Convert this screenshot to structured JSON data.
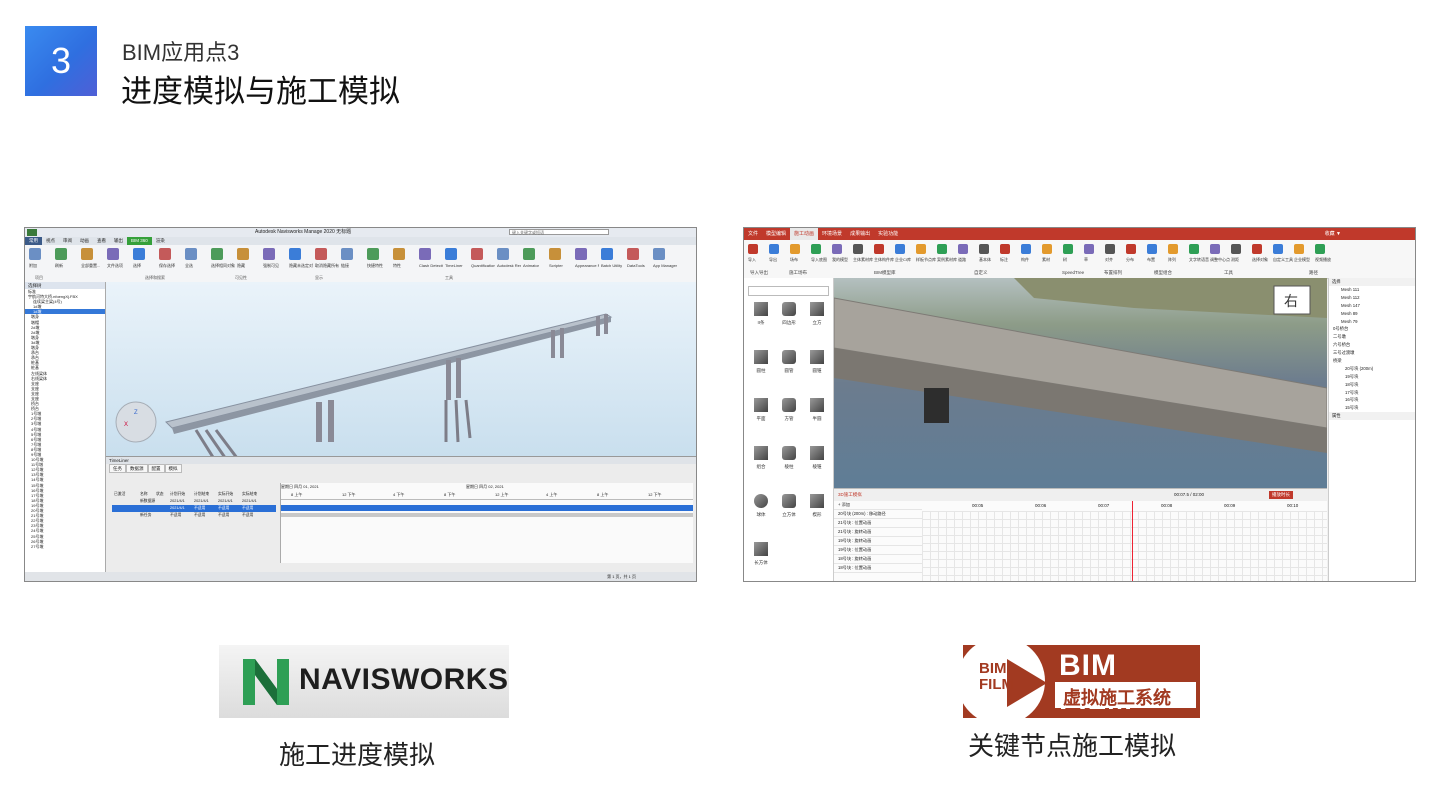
{
  "section": {
    "number": "3",
    "subtitle": "BIM应用点3",
    "title": "进度模拟与施工模拟"
  },
  "navisworks": {
    "window_title": "Autodesk Navisworks Manage 2020  无标题",
    "search_placeholder": "键入关键字或短语",
    "tabs": [
      "常用",
      "视点",
      "审阅",
      "动画",
      "查看",
      "输出",
      "BIM 360",
      "渲染"
    ],
    "ribbon_items": [
      "附加",
      "刷新",
      "全部重置...",
      "文件选项",
      "选择",
      "保存选择",
      "全选",
      "选择相同对象",
      "隐藏",
      "强制可见",
      "隐藏未选定对象",
      "取消隐藏所有对象",
      "链接",
      "快捷特性",
      "特性",
      "Clash Detective",
      "TimeLiner",
      "Quantification",
      "Autodesk Rendering",
      "Animator",
      "Scripter",
      "Appearance Profiler",
      "Batch Utility",
      "DataTools",
      "App Manager"
    ],
    "ribbon_groups": [
      "项目",
      "选择和搜索",
      "可见性",
      "显示",
      "工具"
    ],
    "tree_header": "选择树",
    "tree_dropdown": "标准",
    "tree_items": [
      "标准",
      "宇航河特大桥.nfoengXj.FBX",
      "连续梁主梁(4号)",
      "1#墩",
      "1#墩",
      "墩身",
      "墩帽",
      "2#墩",
      "2#墩",
      "墩身",
      "3#墩",
      "墩身",
      "承台",
      "承台",
      "桩基",
      "桩基",
      "左线梁体",
      "右线梁体",
      "支座",
      "支座",
      "支座",
      "支座",
      "桥台",
      "桥台",
      "1号墩",
      "2号墩",
      "3号墩",
      "4号墩",
      "5号墩",
      "6号墩",
      "7号墩",
      "8号墩",
      "9号墩",
      "10号墩",
      "11号墩",
      "12号墩",
      "13号墩",
      "14号墩",
      "15号墩",
      "16号墩",
      "17号墩",
      "18号墩",
      "19号墩",
      "20号墩",
      "21号墩",
      "22号墩",
      "23号墩",
      "24号墩",
      "25号墩",
      "26号墩",
      "27号墩"
    ],
    "timeliner": {
      "title": "TimeLiner",
      "tabs": [
        "任务",
        "数据源",
        "配置",
        "模拟"
      ],
      "columns": [
        "已激活",
        "名称",
        "状态",
        "计划开始",
        "计划结束",
        "实际开始",
        "实际结束"
      ],
      "rows": [
        [
          "",
          "新数据源",
          "",
          "2021/4/1",
          "2021/4/1",
          "2021/4/1",
          "2021/4/1"
        ],
        [
          "",
          "",
          "",
          "2021/4/1",
          "不适用",
          "不适用",
          "不适用"
        ],
        [
          "",
          "新任务",
          "",
          "不适用",
          "不适用",
          "不适用",
          "不适用"
        ]
      ],
      "scale_top": [
        "星期日 四月 01, 2021",
        "星期日 四月 02, 2021"
      ],
      "scale_bottom": [
        "8 上午",
        "12 下午",
        "4 下午",
        "8 下午",
        "12 上午",
        "4 上午",
        "8 上午",
        "12 下午"
      ]
    },
    "status_text": "第 1 页，共 1 页"
  },
  "bimfilm": {
    "top_tabs": [
      "文件",
      "模型编辑",
      "施工动画",
      "环境场景",
      "成果输出",
      "实验功能"
    ],
    "active_tab": "施工动画",
    "user": "收藏 ▼",
    "ribbon_items": [
      "导入",
      "导出",
      "场布",
      "导入底图",
      "我的模型",
      "主体素材库",
      "主体构件库",
      "企业CI库",
      "样板节点库",
      "案例素材库",
      "道路",
      "基本体",
      "标注",
      "构件",
      "素材",
      "树",
      "草",
      "对齐",
      "分布",
      "布置",
      "阵列",
      "文字转语音",
      "调整中心点",
      "测距",
      "选择对象",
      "自定义工具",
      "企业模型",
      "视频播放"
    ],
    "ribbon_groups": [
      "导入导出",
      "施工场布",
      "BIM模型库",
      "自定义",
      "SpeedTree",
      "布置排列",
      "模型组合",
      "工具",
      "路径"
    ],
    "library_items": [
      "II条",
      "四边形",
      "立方",
      "圆柱",
      "圆管",
      "圆锥",
      "平面",
      "方管",
      "半圆",
      "组合",
      "棱柱",
      "棱锥",
      "球体",
      "立方体",
      "楔形",
      "长方体"
    ],
    "view_cube_label": "右",
    "right_panel": {
      "header": "选择",
      "meshes": [
        "Mesh 111",
        "Mesh 112",
        "Mesh 147",
        "Mesh 89",
        "Mesh 79"
      ],
      "groups": [
        "0号桥台",
        "二号墩",
        "六号桥台",
        "三号过渡墩",
        "桥梁"
      ],
      "beam_items": [
        "20号块 (200m)",
        "19号块",
        "18号块",
        "17号块",
        "16号块",
        "15号块"
      ],
      "properties_label": "属性"
    },
    "timeline": {
      "dropdown": "3D施工模拟",
      "add_label": "添加",
      "time_readout": "00:07.5 / 02:00",
      "button": "播放时长",
      "ticks": [
        "00:05",
        "00:06",
        "00:07",
        "00:08",
        "00:09",
        "00:10"
      ],
      "tracks": [
        "20号块 (200m) : 移动路径",
        "21号块 : 位置动画",
        "21号块 : 旋转动画",
        "19号块 : 旋转动画",
        "19号块 : 位置动画",
        "18号块 : 旋转动画",
        "18号块 : 位置动画"
      ]
    }
  },
  "logos": {
    "navisworks_text": "NAVISWORKS",
    "bimfilm_mark": "BIM FILM",
    "bimfilm_text": "BIM FILM",
    "bimfilm_subtext": "虚拟施工系统"
  },
  "captions": {
    "left": "施工进度模拟",
    "right": "关键节点施工模拟"
  }
}
